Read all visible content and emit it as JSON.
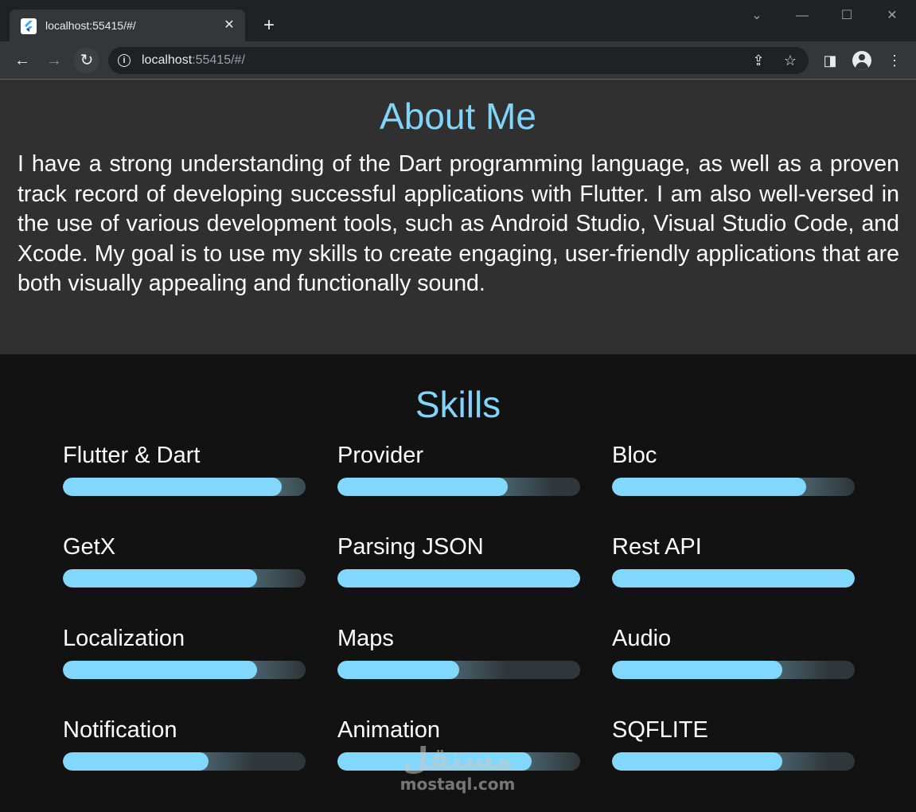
{
  "browser": {
    "tab_title": "localhost:55415/#/",
    "tab_close": "✕",
    "new_tab": "+",
    "url_host": "localhost",
    "url_rest": ":55415/#/"
  },
  "about": {
    "title": "About Me",
    "text": "I have a strong understanding of the Dart programming language, as well as a proven track record of developing successful applications with Flutter. I am also well-versed in the use of various development tools, such as Android Studio, Visual Studio Code, and Xcode. My goal is to use my skills to create engaging, user-friendly applications that are both visually appealing and functionally sound."
  },
  "skills": {
    "title": "Skills",
    "items": [
      {
        "name": "Flutter & Dart",
        "level": 0.9
      },
      {
        "name": "Provider",
        "level": 0.7
      },
      {
        "name": "Bloc",
        "level": 0.8
      },
      {
        "name": "GetX",
        "level": 0.8
      },
      {
        "name": "Parsing JSON",
        "level": 1.0
      },
      {
        "name": "Rest API",
        "level": 1.0
      },
      {
        "name": "Localization",
        "level": 0.8
      },
      {
        "name": "Maps",
        "level": 0.5
      },
      {
        "name": "Audio",
        "level": 0.7
      },
      {
        "name": "Notification",
        "level": 0.6
      },
      {
        "name": "Animation",
        "level": 0.8
      },
      {
        "name": "SQFLITE",
        "level": 0.7
      }
    ]
  },
  "watermark": {
    "arabic": "مستقل",
    "latin": "mostaql.com"
  },
  "colors": {
    "accent": "#81d4fa",
    "bar_fill": "#81d8fc",
    "bar_track": "#2f373b",
    "about_bg": "#303030",
    "skills_bg": "#121212"
  }
}
